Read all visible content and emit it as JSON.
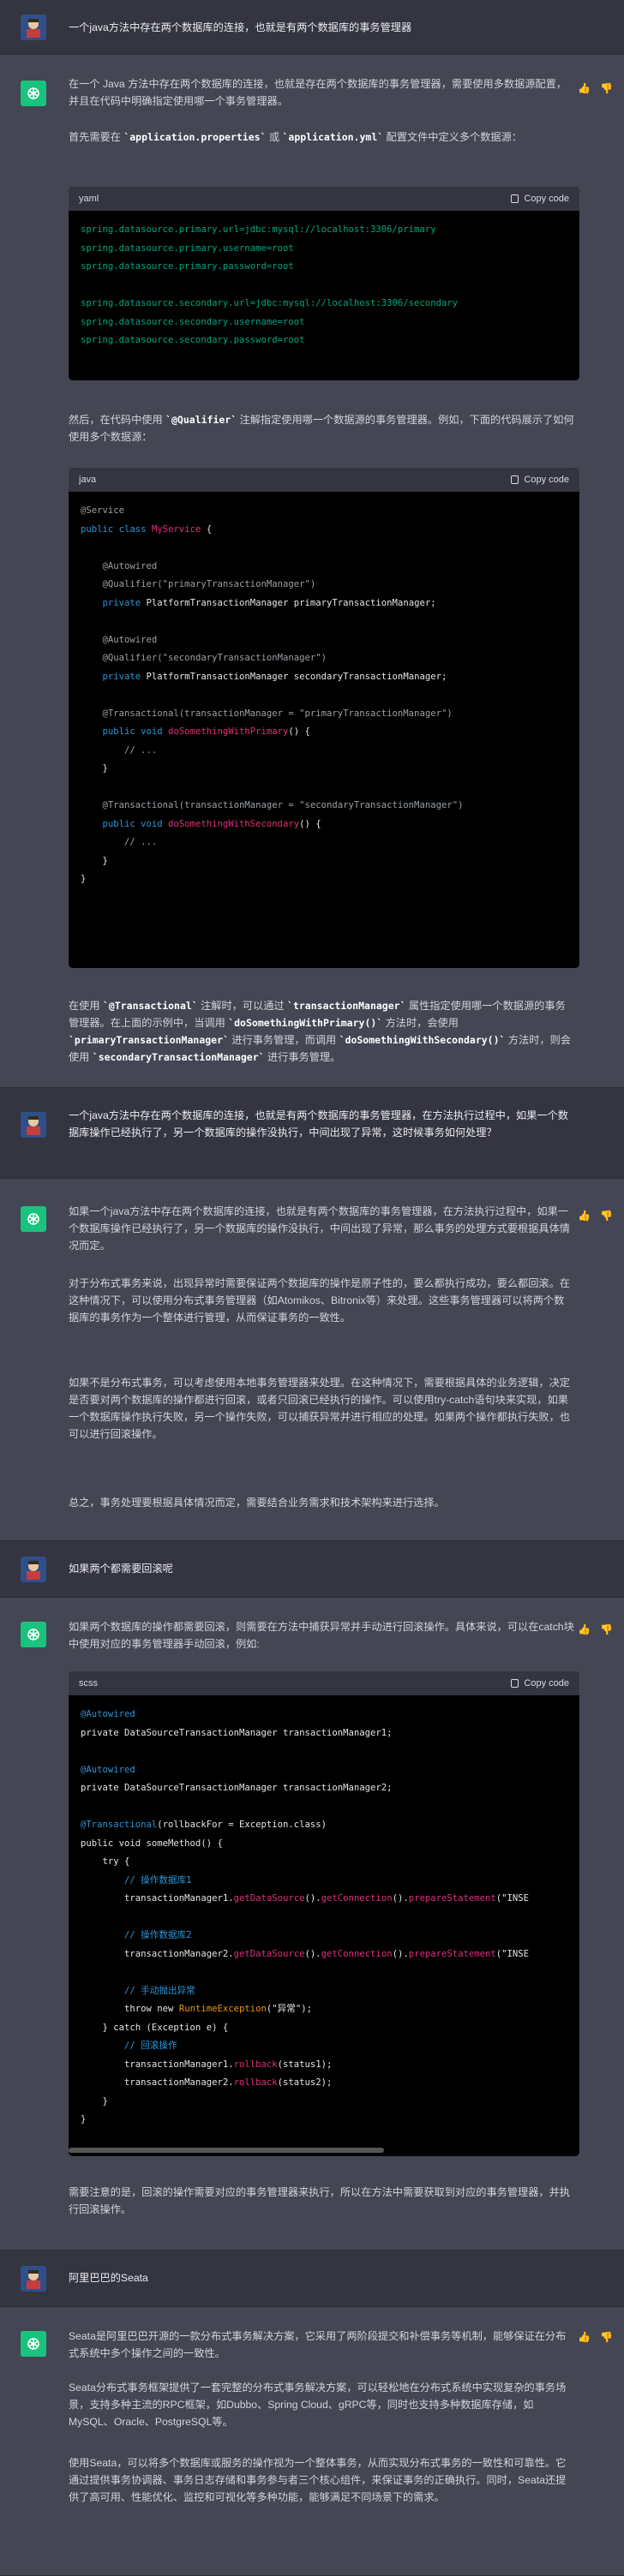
{
  "turns": [
    {
      "role": "user",
      "text": "一个java方法中存在两个数据库的连接，也就是有两个数据库的事务管理器"
    },
    {
      "role": "assistant",
      "p1": "在一个 Java 方法中存在两个数据库的连接，也就是存在两个数据库的事务管理器，需要使用多数据源配置，并且在代码中明确指定使用哪一个事务管理器。",
      "p2_a": "首先需要在 ",
      "p2_code1": "`application.properties`",
      "p2_b": " 或 ",
      "p2_code2": "`application.yml`",
      "p2_c": " 配置文件中定义多个数据源：",
      "code1_lang": "yaml",
      "code1_copy": "Copy code",
      "p3_a": "然后，在代码中使用 ",
      "p3_code": "`@Qualifier`",
      "p3_b": " 注解指定使用哪一个数据源的事务管理器。例如，下面的代码展示了如何使用多个数据源：",
      "code2_lang": "java",
      "code2_copy": "Copy code",
      "p4_a": "在使用 ",
      "p4_c1": "`@Transactional`",
      "p4_b": " 注解时，可以通过 ",
      "p4_c2": "`transactionManager`",
      "p4_c": " 属性指定使用哪一个数据源的事务管理器。在上面的示例中，当调用 ",
      "p4_c3": "`doSomethingWithPrimary()`",
      "p4_d": " 方法时，会使用 ",
      "p4_c4": "`primaryTransactionManager`",
      "p4_e": " 进行事务管理，而调用 ",
      "p4_c5": "`doSomethingWithSecondary()`",
      "p4_f": " 方法时，则会使用 ",
      "p4_c6": "`secondaryTransactionManager`",
      "p4_g": " 进行事务管理。"
    },
    {
      "role": "user",
      "text": "一个java方法中存在两个数据库的连接，也就是有两个数据库的事务管理器，在方法执行过程中，如果一个数据库操作已经执行了，另一个数据库的操作没执行，中间出现了异常，这时候事务如何处理？"
    },
    {
      "role": "assistant",
      "p1": "如果一个java方法中存在两个数据库的连接，也就是有两个数据库的事务管理器，在方法执行过程中，如果一个数据库操作已经执行了，另一个数据库的操作没执行，中间出现了异常，那么事务的处理方式要根据具体情况而定。",
      "p2": "对于分布式事务来说，出现异常时需要保证两个数据库的操作是原子性的，要么都执行成功，要么都回滚。在这种情况下，可以使用分布式事务管理器（如Atomikos、Bitronix等）来处理。这些事务管理器可以将两个数据库的事务作为一个整体进行管理，从而保证事务的一致性。",
      "p3": "如果不是分布式事务，可以考虑使用本地事务管理器来处理。在这种情况下，需要根据具体的业务逻辑，决定是否要对两个数据库的操作都进行回滚，或者只回滚已经执行的操作。可以使用try-catch语句块来实现，如果一个数据库操作执行失败，另一个操作失败，可以捕获异常并进行相应的处理。如果两个操作都执行失败，也可以进行回滚操作。",
      "p4": "总之，事务处理要根据具体情况而定，需要结合业务需求和技术架构来进行选择。"
    },
    {
      "role": "user",
      "text": "如果两个都需要回滚呢"
    },
    {
      "role": "assistant",
      "p1": "如果两个数据库的操作都需要回滚，则需要在方法中捕获异常并手动进行回滚操作。具体来说，可以在catch块中使用对应的事务管理器手动回滚，例如:",
      "code_lang": "scss",
      "code_copy": "Copy code",
      "p2": "需要注意的是，回滚的操作需要对应的事务管理器来执行，所以在方法中需要获取到对应的事务管理器，并执行回滚操作。"
    },
    {
      "role": "user",
      "text": "阿里巴巴的Seata"
    },
    {
      "role": "assistant",
      "p1": "Seata是阿里巴巴开源的一款分布式事务解决方案，它采用了两阶段提交和补偿事务等机制，能够保证在分布式系统中多个操作之间的一致性。",
      "p2": "Seata分布式事务框架提供了一套完整的分布式事务解决方案，可以轻松地在分布式系统中实现复杂的事务场景，支持多种主流的RPC框架，如Dubbo、Spring Cloud、gRPC等，同时也支持多种数据库存储，如MySQL、Oracle、PostgreSQL等。",
      "p3": "使用Seata，可以将多个数据库或服务的操作视为一个整体事务，从而实现分布式事务的一致性和可靠性。它通过提供事务协调器、事务日志存储和事务参与者三个核心组件，来保证事务的正确执行。同时，Seata还提供了高可用、性能优化、监控和可视化等多种功能，能够满足不同场景下的需求。"
    }
  ]
}
